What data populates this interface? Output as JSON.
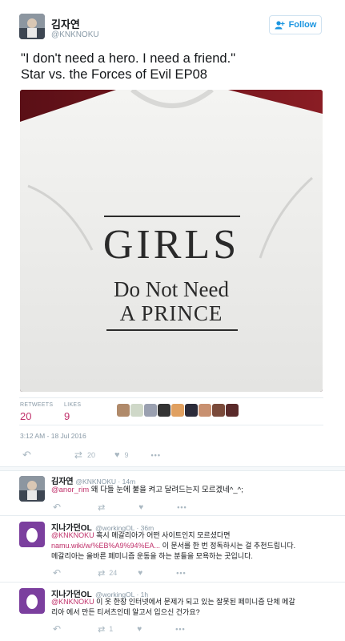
{
  "main_tweet": {
    "name": "김자연",
    "handle": "@KNKNOKU",
    "follow_label": "Follow",
    "text_line1": "\"I don't need a hero. I need a friend.\"",
    "text_line2": "Star vs. the Forces of Evil EP08",
    "shirt": {
      "line1": "GIRLS",
      "line2": "Do Not Need",
      "line3": "A PRINCE"
    },
    "retweets_label": "RETWEETS",
    "retweets_count": "20",
    "likes_label": "LIKES",
    "likes_count": "9",
    "timestamp": "3:12 AM - 18 Jul 2016",
    "action_retweets": "20",
    "action_likes": "9"
  },
  "replies": [
    {
      "name": "김자연",
      "handle": "@KNKNOKU · 14m",
      "mention": "@anor_rim",
      "text": " 왜 다들 눈에 불을 켜고 달려드는지 모르겠네^_^;"
    },
    {
      "name": "지나가던OL",
      "handle": "@workingOL · 36m",
      "mention": "@KNKNOKU",
      "text1": " 혹시 메갈리아가 어떤 사이트인지 모르셨다면",
      "link": "namu.wiki/w/%EB%A9%94%EA...",
      "text2": " 이 문서를 한 번 정독하시는 걸 추천드립니다.",
      "text3": "메갈리아는 올바른 페미니즘 운동을 하는 분들을 모욕하는 곳입니다.",
      "retweets": "24"
    },
    {
      "name": "지나가던OL",
      "handle": "@workingOL · 1h",
      "mention": "@KNKNOKU",
      "text1": " 이 옷 한창 인터넷에서 문제가 되고 있는 잘못된 페미니즘 단체 메갈",
      "text2": "리아 에서 만든 티셔츠인데 알고서 입으신 건가요?",
      "retweets": "1"
    }
  ],
  "icons": {
    "reply": "reply-icon",
    "retweet": "retweet-icon",
    "like": "heart-icon",
    "more": "more-icon",
    "follow": "add-user-icon"
  },
  "colors": {
    "link": "#1b95e0",
    "mention": "#c0306a",
    "muted": "#8899a6",
    "egg_bg": "#7b3f9e"
  }
}
